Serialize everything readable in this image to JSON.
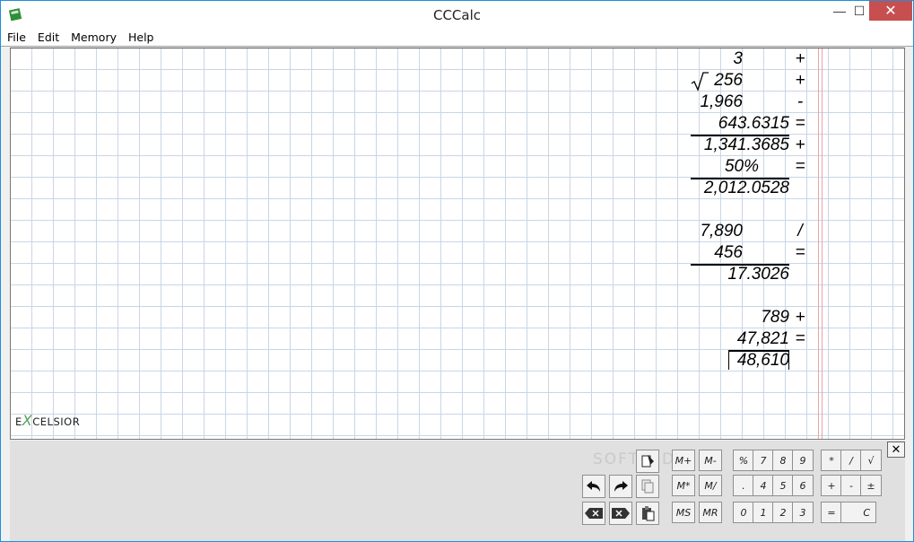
{
  "window": {
    "title": "CCCalc",
    "min_glyph": "—",
    "max_glyph": "☐",
    "close_glyph": "✕"
  },
  "menu": [
    "File",
    "Edit",
    "Memory",
    "Help"
  ],
  "tape": {
    "lines": [
      {
        "value": "3",
        "op": "+"
      },
      {
        "value": "256",
        "op": "+",
        "sqrt": true
      },
      {
        "value": "1,966",
        "op": "-"
      },
      {
        "value": "643.6315",
        "op": "="
      },
      {
        "value": "1,341.3685",
        "op": "+"
      },
      {
        "value": "50%",
        "op": "="
      },
      {
        "value": "2,012.0528",
        "op": ""
      },
      {
        "value": "7,890",
        "op": "/"
      },
      {
        "value": "456",
        "op": "="
      },
      {
        "value": "17.3026",
        "op": ""
      },
      {
        "value": "789",
        "op": "+"
      },
      {
        "value": "47,821",
        "op": "="
      },
      {
        "value": "48,610",
        "op": ""
      }
    ]
  },
  "logo": {
    "prefix": "E",
    "x": "X",
    "rest": "CELSIOR"
  },
  "keypad": {
    "memory": [
      "M+",
      "M-",
      "M*",
      "M/",
      "MS",
      "MR"
    ],
    "digits_row1": [
      "%",
      "7",
      "8",
      "9"
    ],
    "digits_row2": [
      ".",
      "4",
      "5",
      "6"
    ],
    "digits_row3": [
      "0",
      "1",
      "2",
      "3"
    ],
    "ops_row1": [
      "*",
      "/",
      "√"
    ],
    "ops_row2": [
      "+",
      "-",
      "±"
    ],
    "ops_row3": [
      "=",
      "C"
    ],
    "panel_close": "✕",
    "watermark": "SOFTPEDIA"
  }
}
